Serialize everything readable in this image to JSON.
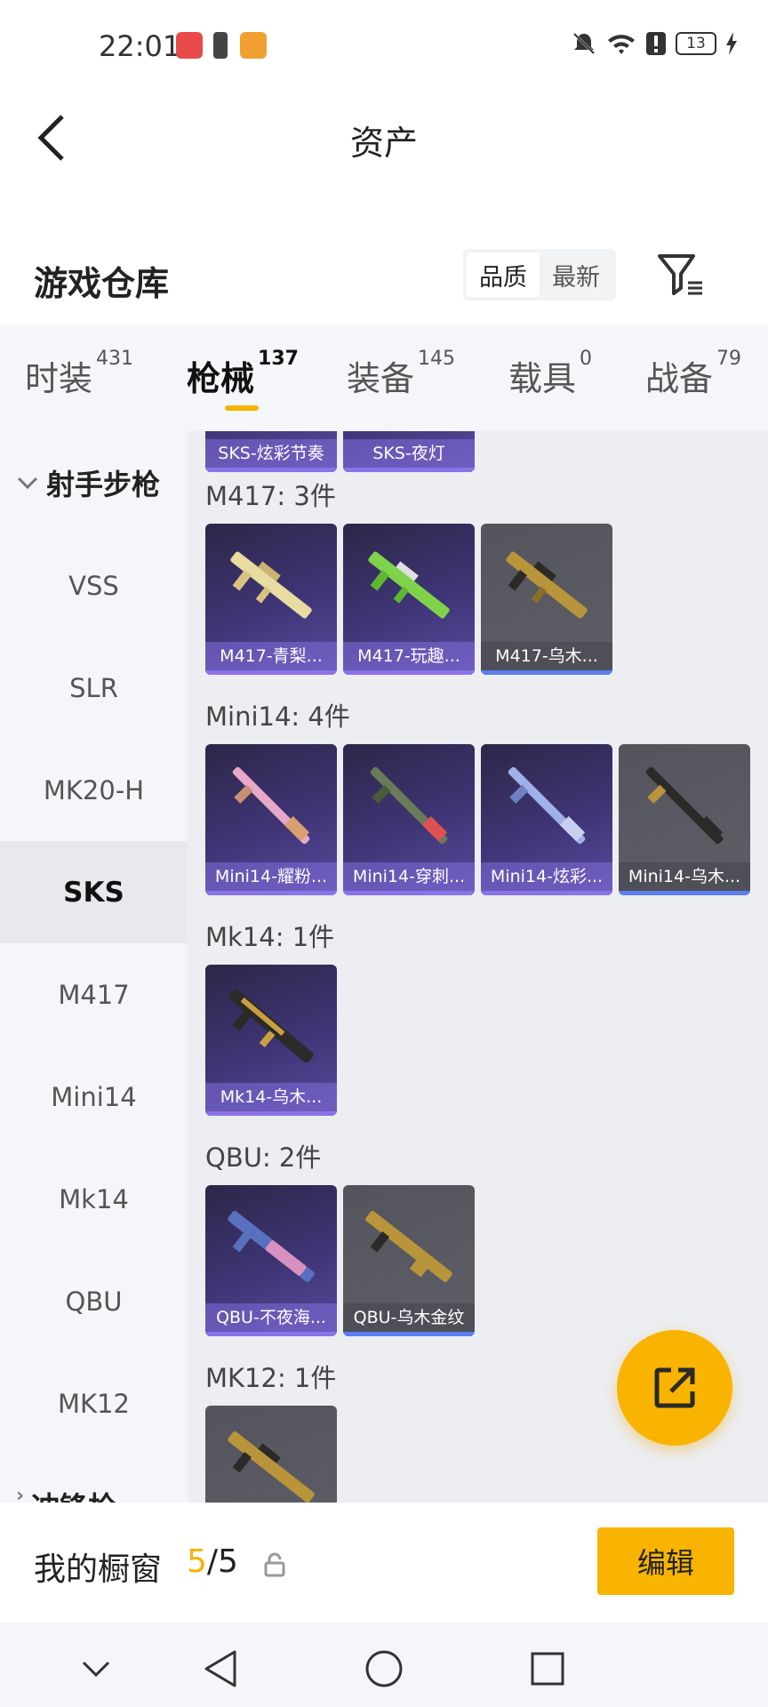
{
  "status_bar": {
    "time": "22:01",
    "battery": "13",
    "icons": [
      "huawei-app-icon",
      "battery-saver-icon",
      "game-app-icon",
      "mute-icon",
      "wifi-icon",
      "alert-icon",
      "battery-icon",
      "charging-icon"
    ]
  },
  "header": {
    "title": "资产",
    "back_icon": "back-arrow-icon"
  },
  "warehouse": {
    "title": "游戏仓库",
    "sort_options": [
      "品质",
      "最新"
    ],
    "sort_selected": "品质",
    "filter_icon": "filter-icon"
  },
  "tabs": [
    {
      "label": "时装",
      "count": "431"
    },
    {
      "label": "枪械",
      "count": "137"
    },
    {
      "label": "装备",
      "count": "145"
    },
    {
      "label": "载具",
      "count": "0"
    },
    {
      "label": "战备",
      "count": "79"
    }
  ],
  "active_tab": "枪械",
  "sidebar": {
    "category": "射手步枪",
    "items": [
      "VSS",
      "SLR",
      "MK20-H",
      "SKS",
      "M417",
      "Mini14",
      "Mk14",
      "QBU",
      "MK12"
    ],
    "active_item": "SKS",
    "next_category": "冲锋枪"
  },
  "groups": [
    {
      "title": "SKS-炫彩节奏",
      "items": [
        {
          "label": "SKS-炫彩节奏",
          "rarity": "purple"
        },
        {
          "label": "SKS-夜灯",
          "rarity": "purple"
        }
      ]
    },
    {
      "title": "M417: 3件",
      "items": [
        {
          "label": "M417-青梨...",
          "rarity": "purple"
        },
        {
          "label": "M417-玩趣...",
          "rarity": "purple"
        },
        {
          "label": "M417-乌木...",
          "rarity": "gray"
        }
      ]
    },
    {
      "title": "Mini14: 4件",
      "items": [
        {
          "label": "Mini14-耀粉...",
          "rarity": "purple"
        },
        {
          "label": "Mini14-穿刺...",
          "rarity": "purple"
        },
        {
          "label": "Mini14-炫彩...",
          "rarity": "purple"
        },
        {
          "label": "Mini14-乌木...",
          "rarity": "gray"
        }
      ]
    },
    {
      "title": "Mk14: 1件",
      "items": [
        {
          "label": "Mk14-乌木...",
          "rarity": "purple"
        }
      ]
    },
    {
      "title": "QBU: 2件",
      "items": [
        {
          "label": "QBU-不夜海...",
          "rarity": "purple"
        },
        {
          "label": "QBU-乌木金纹",
          "rarity": "gray"
        }
      ]
    },
    {
      "title": "MK12: 1件",
      "items": [
        {
          "label": "",
          "rarity": "gray"
        }
      ]
    }
  ],
  "fab": {
    "icon": "share-icon"
  },
  "showcase": {
    "title": "我的橱窗",
    "current": "5",
    "separator": "/",
    "total": "5",
    "lock_icon": "lock-icon",
    "edit_label": "编辑"
  },
  "system_nav": {
    "icons": [
      "collapse-icon",
      "back-triangle-icon",
      "home-circle-icon",
      "recents-square-icon"
    ]
  },
  "colors": {
    "accent": "#f8b400",
    "purple_card": "#3f3576",
    "gray_card": "#5e5e66",
    "sidebar_bg": "#f4f6f9",
    "content_bg": "#eceef2"
  }
}
